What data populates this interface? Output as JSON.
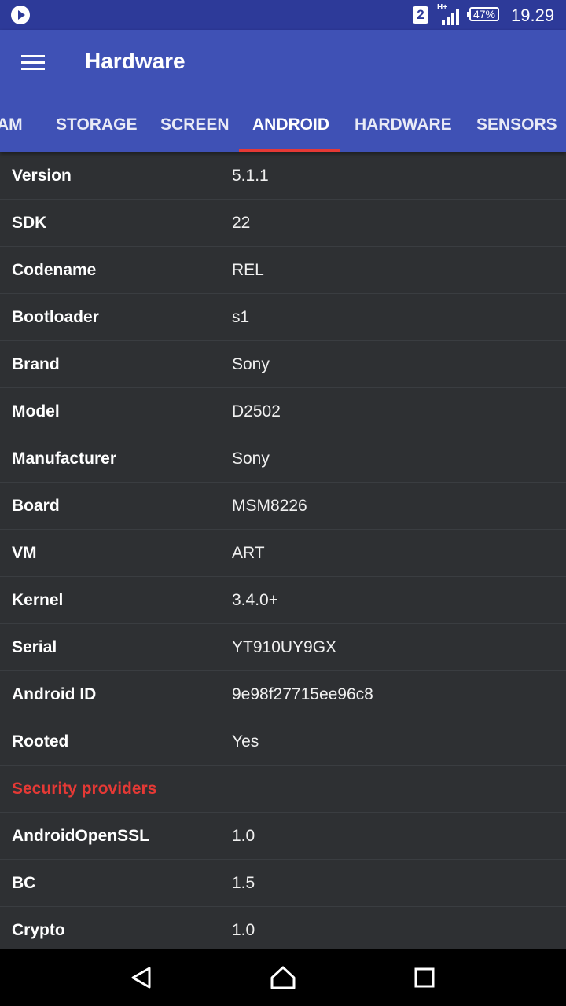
{
  "status_bar": {
    "sim_slot": "2",
    "network_type": "H+",
    "battery": "47%",
    "time": "19.29"
  },
  "app_bar": {
    "title": "Hardware",
    "tabs": [
      {
        "label": "AM",
        "active": false
      },
      {
        "label": "STORAGE",
        "active": false
      },
      {
        "label": "SCREEN",
        "active": false
      },
      {
        "label": "ANDROID",
        "active": true
      },
      {
        "label": "HARDWARE",
        "active": false
      },
      {
        "label": "SENSORS",
        "active": false
      }
    ]
  },
  "rows": [
    {
      "label": "Version",
      "value": "5.1.1"
    },
    {
      "label": "SDK",
      "value": "22"
    },
    {
      "label": "Codename",
      "value": "REL"
    },
    {
      "label": "Bootloader",
      "value": "s1"
    },
    {
      "label": "Brand",
      "value": "Sony"
    },
    {
      "label": "Model",
      "value": "D2502"
    },
    {
      "label": "Manufacturer",
      "value": "Sony"
    },
    {
      "label": "Board",
      "value": "MSM8226"
    },
    {
      "label": "VM",
      "value": "ART"
    },
    {
      "label": "Kernel",
      "value": "3.4.0+"
    },
    {
      "label": "Serial",
      "value": "YT910UY9GX"
    },
    {
      "label": "Android ID",
      "value": "9e98f27715ee96c8"
    },
    {
      "label": "Rooted",
      "value": "Yes"
    },
    {
      "label": "Security providers",
      "value": "",
      "header": true
    },
    {
      "label": "AndroidOpenSSL",
      "value": "1.0"
    },
    {
      "label": "BC",
      "value": "1.5"
    },
    {
      "label": "Crypto",
      "value": "1.0"
    }
  ],
  "nav_bar": {
    "back_icon": "back-triangle-icon",
    "home_icon": "home-icon",
    "recents_icon": "recents-square-icon"
  },
  "colors": {
    "status_bar": "#2d3a99",
    "app_bar": "#3f51b5",
    "background": "#2e3033",
    "accent": "#e53935"
  }
}
